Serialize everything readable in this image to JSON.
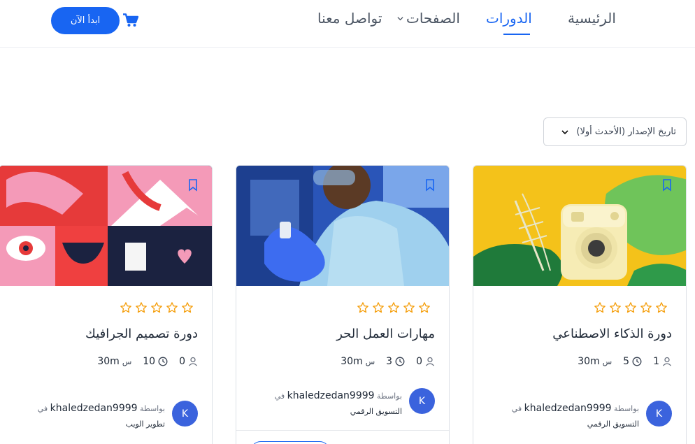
{
  "header": {
    "start_button": "ابدأ الآن",
    "nav": {
      "home": "الرئيسية",
      "courses": "الدورات",
      "pages": "الصفحات",
      "contact": "تواصل معنا"
    }
  },
  "sort": {
    "selected": "تاريخ الإصدار (الأحدث أولا)"
  },
  "colors": {
    "accent": "#1865f2",
    "star": "#f59e0b",
    "avatar": "#3b63dd"
  },
  "courses": [
    {
      "title": "دورة الذكاء الاصطناعي",
      "rating": 0,
      "students": "1",
      "duration_hours": "5",
      "hours_suffix": "س",
      "duration_minutes": "30m",
      "by": "بواسطة",
      "author": "khaledzedan9999",
      "in": "في",
      "category": "التسويق الرقمي",
      "avatar": "K"
    },
    {
      "title": "مهارات العمل الحر",
      "rating": 0,
      "students": "0",
      "duration_hours": "3",
      "hours_suffix": "س",
      "duration_minutes": "30m",
      "by": "بواسطة",
      "author": "khaledzedan9999",
      "in": "في",
      "category": "التسويق الرقمي",
      "avatar": "K"
    },
    {
      "title": "دورة تصميم الجرافيك",
      "rating": 0,
      "students": "0",
      "duration_hours": "10",
      "hours_suffix": "س",
      "duration_minutes": "30m",
      "by": "بواسطة",
      "author": "khaledzedan9999",
      "in": "في",
      "category": "تطوير الويب",
      "avatar": "K"
    }
  ]
}
